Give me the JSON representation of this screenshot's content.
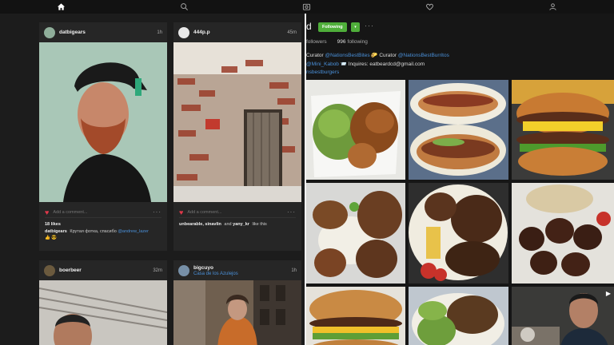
{
  "colors": {
    "accent": "#4a90d9",
    "following": "#4fae3a",
    "heart": "#e0384a"
  },
  "nav": [
    {
      "icon": "home-icon"
    },
    {
      "icon": "search-icon"
    },
    {
      "icon": "camera-icon"
    },
    {
      "icon": "heart-icon"
    },
    {
      "icon": "profile-icon"
    }
  ],
  "feed": {
    "posts": [
      {
        "user": "datbigears",
        "time": "1h",
        "comment_placeholder": "Add a comment...",
        "likes": "18 likes",
        "caption_user": "datbigears",
        "caption": "Крутая фотка, спасибо",
        "mention": "@andrew_lazer",
        "emoji": "👍 😎"
      },
      {
        "user": "444p.p",
        "time": "45m",
        "comment_placeholder": "Add a comment...",
        "liked_by": "unbearable, sinavlin",
        "liked_and": "and",
        "liked_by2": "yany_kr",
        "liked_suffix": "like this"
      },
      {
        "user": "boerbeer",
        "time": "32m"
      },
      {
        "user": "bigcuyo",
        "time": "1h",
        "location": "Casa de los Azulejos"
      }
    ]
  },
  "profile": {
    "name_fragment": "d",
    "follow_label": "Following",
    "caret": "▾",
    "more": "···",
    "followers_label": "followers",
    "following_count": "996",
    "following_label": "following",
    "bio_line1_prefix": "Curator",
    "bio_line1_link1": "@NationsBestBites",
    "bio_line1_mid": "🌮 Curator",
    "bio_line1_link2": "@NationsBestBurritos",
    "bio_line2_link": "@Mini_Kabob",
    "bio_line2_text": "📨 Inquires: eatbeardcd@gmail.com",
    "bio_line3_link": "nsbestburgers"
  }
}
